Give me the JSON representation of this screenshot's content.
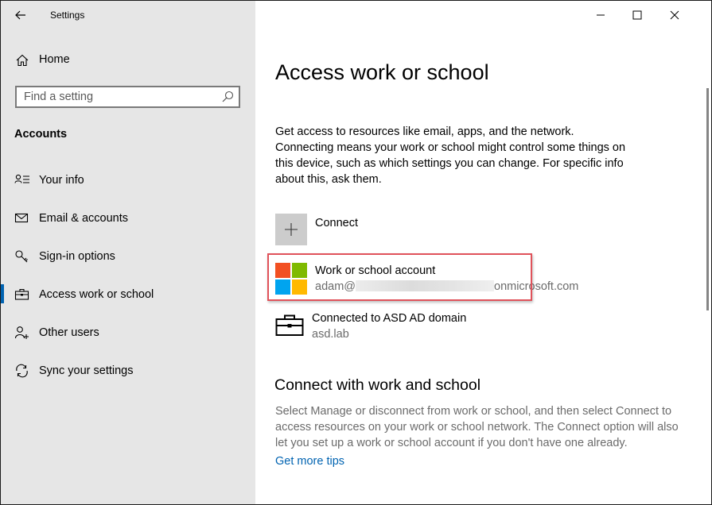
{
  "window": {
    "title": "Settings"
  },
  "sidebar": {
    "home_label": "Home",
    "search_placeholder": "Find a setting",
    "section_title": "Accounts",
    "items": [
      {
        "label": "Your info",
        "icon": "person-card-icon"
      },
      {
        "label": "Email & accounts",
        "icon": "mail-icon"
      },
      {
        "label": "Sign-in options",
        "icon": "key-icon"
      },
      {
        "label": "Access work or school",
        "icon": "briefcase-icon",
        "active": true
      },
      {
        "label": "Other users",
        "icon": "person-add-icon"
      },
      {
        "label": "Sync your settings",
        "icon": "sync-icon"
      }
    ]
  },
  "main": {
    "title": "Access work or school",
    "description": "Get access to resources like email, apps, and the network. Connecting means your work or school might control some things on this device, such as which settings you can change. For specific info about this, ask them.",
    "connect_label": "Connect",
    "accounts": [
      {
        "title": "Work or school account",
        "email_prefix": "adam@",
        "email_suffix": "onmicrosoft.com"
      },
      {
        "title": "Connected to ASD AD domain",
        "subtitle": "asd.lab"
      }
    ],
    "section2_title": "Connect with work and school",
    "section2_description": "Select Manage or disconnect from work or school, and then select Connect to access resources on your work or school network. The Connect option will also let you set up a work or school account if you don't have one already.",
    "tips_link": "Get more tips"
  },
  "colors": {
    "accent": "#0063b1",
    "sidebar_bg": "#e6e6e6",
    "highlight": "#e0525a"
  }
}
